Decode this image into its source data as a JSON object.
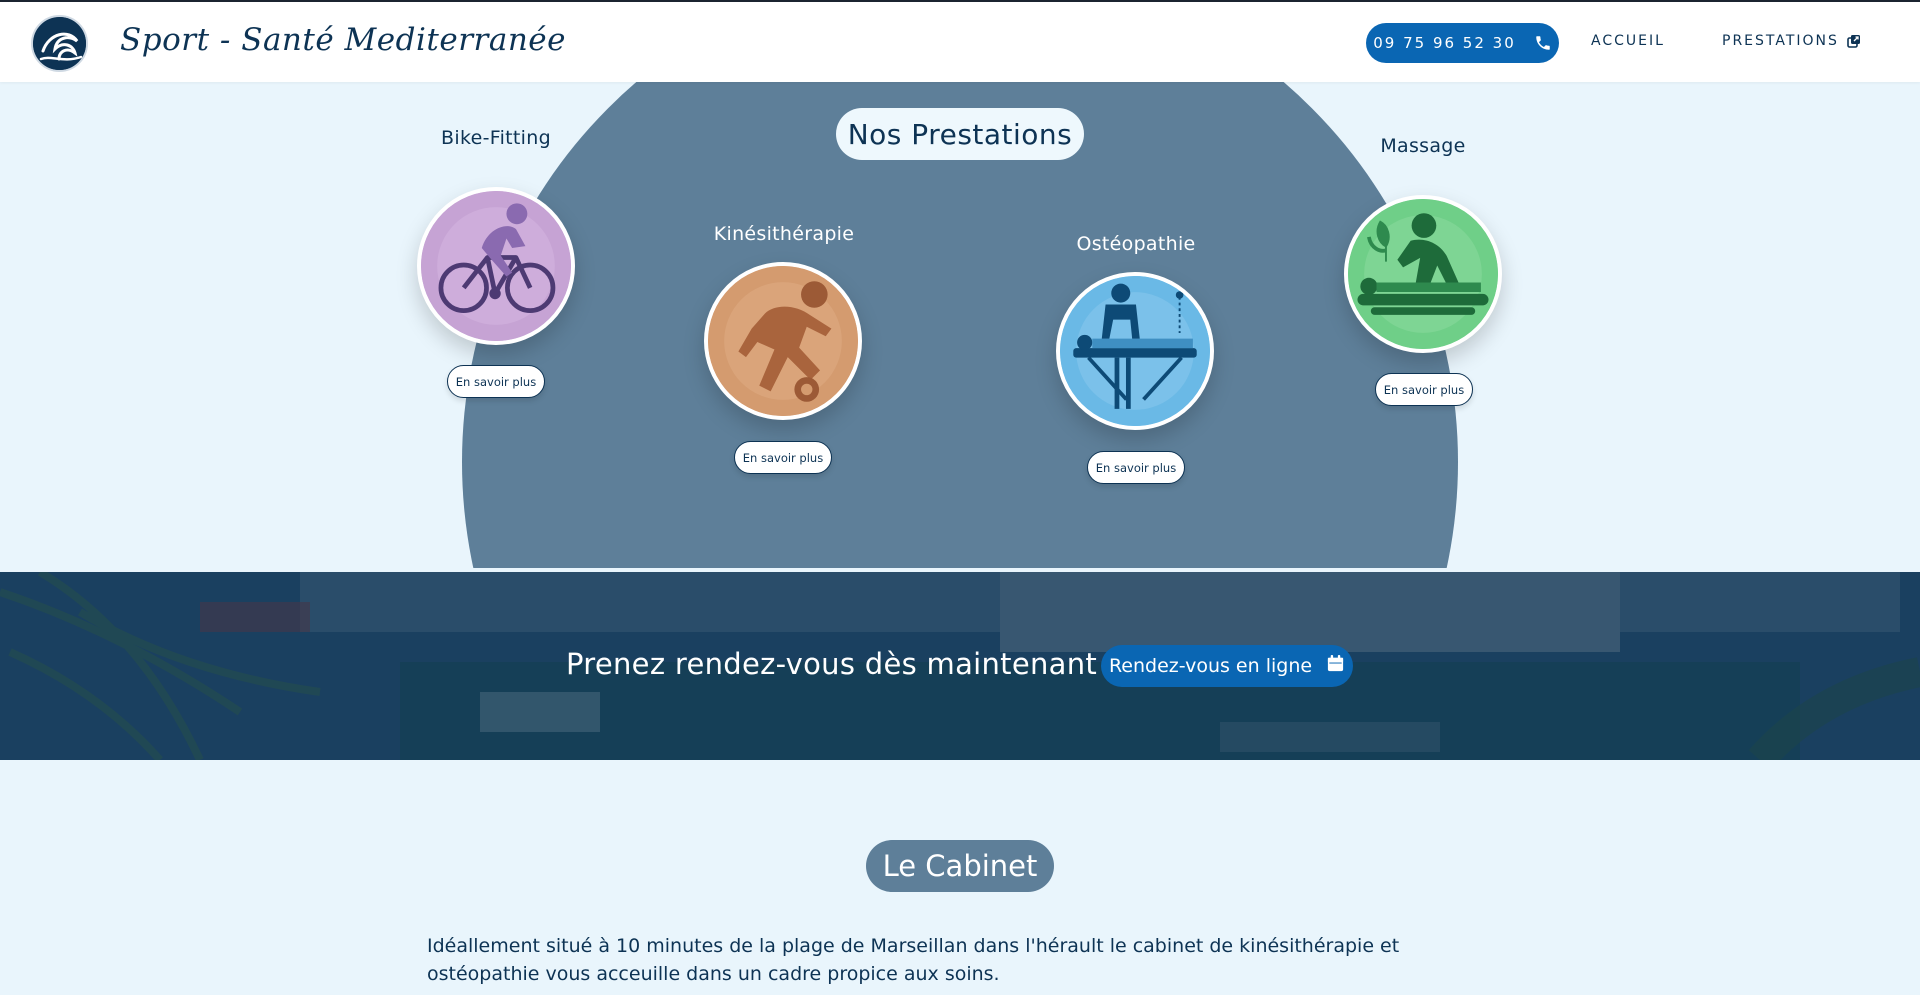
{
  "header": {
    "brand": "Sport - Santé Mediterranée",
    "phone": "09 75 96 52 30",
    "nav": [
      {
        "label": "ACCUEIL"
      },
      {
        "label": "PRESTATIONS"
      }
    ]
  },
  "prestations": {
    "title": "Nos Prestations",
    "services": [
      {
        "name": "Bike-Fitting",
        "button": "En savoir plus",
        "icon": "cyclist-icon",
        "color": "#c6a3d4"
      },
      {
        "name": "Kinésithérapie",
        "button": "En savoir plus",
        "icon": "football-player-icon",
        "color": "#d49b6f"
      },
      {
        "name": "Ostéopathie",
        "button": "En savoir plus",
        "icon": "osteopath-treatment-icon",
        "color": "#6ab9e6"
      },
      {
        "name": "Massage",
        "button": "En savoir plus",
        "icon": "massage-icon",
        "color": "#6fcf88"
      }
    ]
  },
  "banner": {
    "text": "Prenez rendez-vous dès maintenant !",
    "button": "Rendez-vous en ligne"
  },
  "cabinet": {
    "title": "Le Cabinet",
    "text": "Idéallement situé à 10 minutes de la plage de Marseillan dans l'hérault le cabinet de kinésithérapie et ostéopathie vous acceuille dans un cadre propice aux soins."
  },
  "colors": {
    "navy": "#0d3354",
    "accent_blue": "#0a66b3",
    "slate": "#5e7f99",
    "background": "#e9f5fc"
  }
}
